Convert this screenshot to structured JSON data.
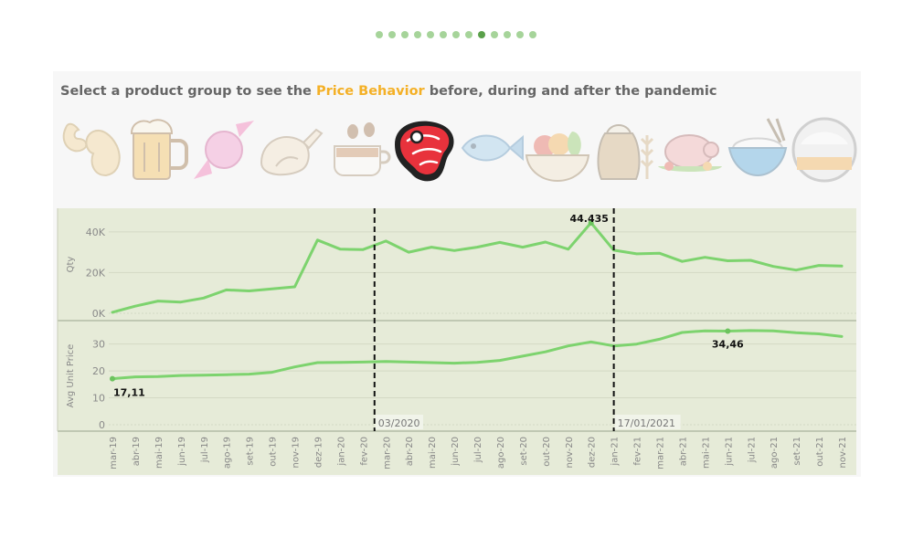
{
  "carousel": {
    "count": 13,
    "active_index": 8
  },
  "header": {
    "prefix": "Select a product group to see the ",
    "highlight": "Price Behavior",
    "suffix": " before, during and after the pandemic",
    "highlight_color": "#f4b026"
  },
  "product_groups": [
    {
      "name": "cashew-icon",
      "selected": false
    },
    {
      "name": "beer-mug-icon",
      "selected": false
    },
    {
      "name": "candy-icon",
      "selected": false
    },
    {
      "name": "chicken-icon",
      "selected": false
    },
    {
      "name": "coffee-icon",
      "selected": false
    },
    {
      "name": "steak-icon",
      "selected": true
    },
    {
      "name": "fish-icon",
      "selected": false
    },
    {
      "name": "fruit-bowl-icon",
      "selected": false
    },
    {
      "name": "grain-sack-icon",
      "selected": false
    },
    {
      "name": "roast-pig-icon",
      "selected": false
    },
    {
      "name": "rice-bowl-icon",
      "selected": false
    },
    {
      "name": "sugar-icon",
      "selected": false
    }
  ],
  "chart_data": {
    "type": "line",
    "x": [
      "mar-19",
      "abr-19",
      "mai-19",
      "jun-19",
      "jul-19",
      "ago-19",
      "set-19",
      "out-19",
      "nov-19",
      "dez-19",
      "jan-20",
      "fev-20",
      "mar-20",
      "abr-20",
      "mai-20",
      "jun-20",
      "jul-20",
      "ago-20",
      "set-20",
      "out-20",
      "nov-20",
      "dez-20",
      "jan-21",
      "fev-21",
      "mar-21",
      "abr-21",
      "mai-21",
      "jun-21",
      "jul-21",
      "ago-21",
      "set-21",
      "out-21",
      "nov-21"
    ],
    "line_color": "#7dd36e",
    "panels": [
      {
        "ylabel": "Qty",
        "ylim": [
          0,
          48000
        ],
        "ticks": [
          0,
          20000,
          40000
        ],
        "tick_labels": [
          "0K",
          "20K",
          "40K"
        ],
        "values": [
          500,
          3500,
          6000,
          5500,
          7500,
          11500,
          11000,
          12000,
          13000,
          36000,
          31500,
          31300,
          35500,
          30000,
          32500,
          30800,
          32500,
          34800,
          32500,
          35000,
          31500,
          44435,
          31000,
          29200,
          29500,
          25500,
          27500,
          25800,
          26000,
          23000,
          21200,
          23500,
          23200
        ],
        "annotation": {
          "index": 21,
          "text": "44.435"
        }
      },
      {
        "ylabel": "Avg Unit Price",
        "ylim": [
          0,
          36
        ],
        "ticks": [
          0,
          10,
          20,
          30
        ],
        "tick_labels": [
          "0",
          "10",
          "20",
          "30"
        ],
        "values": [
          17.11,
          17.8,
          17.9,
          18.3,
          18.4,
          18.6,
          18.8,
          19.5,
          21.5,
          23.1,
          23.2,
          23.3,
          23.5,
          23.3,
          23.1,
          22.9,
          23.2,
          23.9,
          25.5,
          27.1,
          29.3,
          30.8,
          29.3,
          30.0,
          31.8,
          34.3,
          34.9,
          34.8,
          35.0,
          34.9,
          34.2,
          33.8,
          32.8
        ],
        "annotations": [
          {
            "index": 0,
            "text": "17,11"
          },
          {
            "index": 27,
            "text": "34,46"
          }
        ]
      }
    ],
    "reference_lines": [
      {
        "position": 11.5,
        "label": "03/2020"
      },
      {
        "position": 22,
        "label": "17/01/2021"
      }
    ],
    "background": "#e6ebd8"
  }
}
